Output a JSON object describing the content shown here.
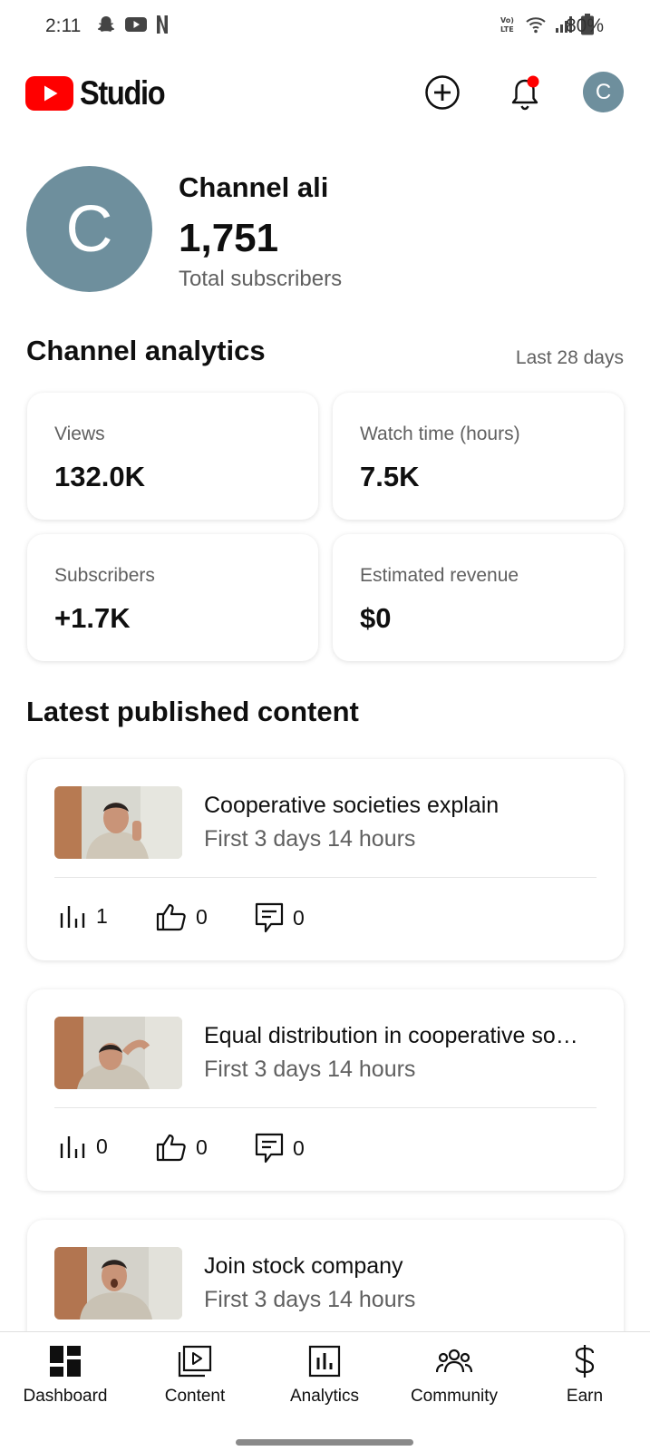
{
  "status_bar": {
    "time": "2:11",
    "battery": "80%"
  },
  "app": {
    "logo_text": "Studio",
    "avatar_letter": "C"
  },
  "channel": {
    "avatar_letter": "C",
    "name": "Channel ali",
    "subscribers": "1,751",
    "subscribers_label": "Total subscribers"
  },
  "analytics": {
    "title": "Channel analytics",
    "range": "Last 28 days",
    "stats": [
      {
        "label": "Views",
        "value": "132.0K"
      },
      {
        "label": "Watch time (hours)",
        "value": "7.5K"
      },
      {
        "label": "Subscribers",
        "value": "+1.7K"
      },
      {
        "label": "Estimated revenue",
        "value": "$0"
      }
    ]
  },
  "latest": {
    "title": "Latest published content",
    "videos": [
      {
        "title": "Cooperative societies explain",
        "subtitle": "First 3 days 14 hours",
        "views": "1",
        "likes": "0",
        "comments": "0"
      },
      {
        "title": "Equal distribution in cooperative so…",
        "subtitle": "First 3 days 14 hours",
        "views": "0",
        "likes": "0",
        "comments": "0"
      },
      {
        "title": "Join stock company",
        "subtitle": "First 3 days 14 hours"
      }
    ]
  },
  "nav": {
    "items": [
      {
        "label": "Dashboard",
        "icon": "dashboard-icon"
      },
      {
        "label": "Content",
        "icon": "content-icon"
      },
      {
        "label": "Analytics",
        "icon": "analytics-icon"
      },
      {
        "label": "Community",
        "icon": "community-icon"
      },
      {
        "label": "Earn",
        "icon": "dollar-icon"
      }
    ]
  },
  "colors": {
    "brand_red": "#ff0000",
    "avatar": "#6e8f9d",
    "notification_dot": "#ff0000"
  }
}
